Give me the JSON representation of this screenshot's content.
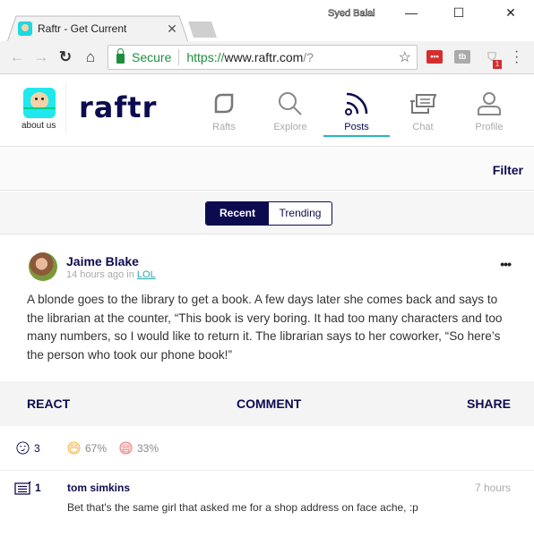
{
  "browser": {
    "tab_title": "Raftr - Get Current",
    "profile_name": "Syed Balal",
    "secure_label": "Secure",
    "url_scheme": "https://",
    "url_host": "www.raftr.com",
    "url_path": "/?",
    "extension_badge": "1",
    "icons": [
      "back-arrow",
      "forward-arrow",
      "reload",
      "home",
      "lock",
      "star",
      "extension-lastpass",
      "extension-tubebuddy",
      "extension-shield",
      "kebab-menu"
    ]
  },
  "site": {
    "about_label": "about us",
    "brand": "raftr",
    "nav": [
      {
        "label": "Rafts",
        "icon": "leaf-icon",
        "active": false
      },
      {
        "label": "Explore",
        "icon": "search-icon",
        "active": false
      },
      {
        "label": "Posts",
        "icon": "rss-icon",
        "active": true
      },
      {
        "label": "Chat",
        "icon": "chat-icon",
        "active": false
      },
      {
        "label": "Profile",
        "icon": "user-icon",
        "active": false
      }
    ],
    "filter_label": "Filter",
    "segments": [
      {
        "label": "Recent",
        "active": true
      },
      {
        "label": "Trending",
        "active": false
      }
    ]
  },
  "post": {
    "author": "Jaime Blake",
    "time": "14 hours ago in",
    "community": "LOL",
    "more_label": "•••",
    "body": "A blonde goes to the library to get a book. A few days later she comes back and says to the librarian at the counter, “This book is very boring. It had too many characters and too many numbers, so I would like to return it. The librarian says to her coworker, “So here’s the person who took our phone book!”",
    "actions": {
      "react": "REACT",
      "comment": "COMMENT",
      "share": "SHARE"
    },
    "reactions": {
      "count": "3",
      "laugh_pct": "67%",
      "angry_pct": "33%",
      "colors": {
        "laugh": "#f5b85a",
        "angry": "#ec7a7a"
      }
    },
    "comments": {
      "count": "1",
      "items": [
        {
          "author": "tom simkins",
          "time": "7 hours",
          "text": "Bet that's the same girl that asked me for a shop address on face ache, :p"
        }
      ]
    }
  },
  "colors": {
    "brand_navy": "#0d0b4f",
    "accent_teal": "#26b5c0",
    "logo_cyan": "#1fe8ee"
  }
}
